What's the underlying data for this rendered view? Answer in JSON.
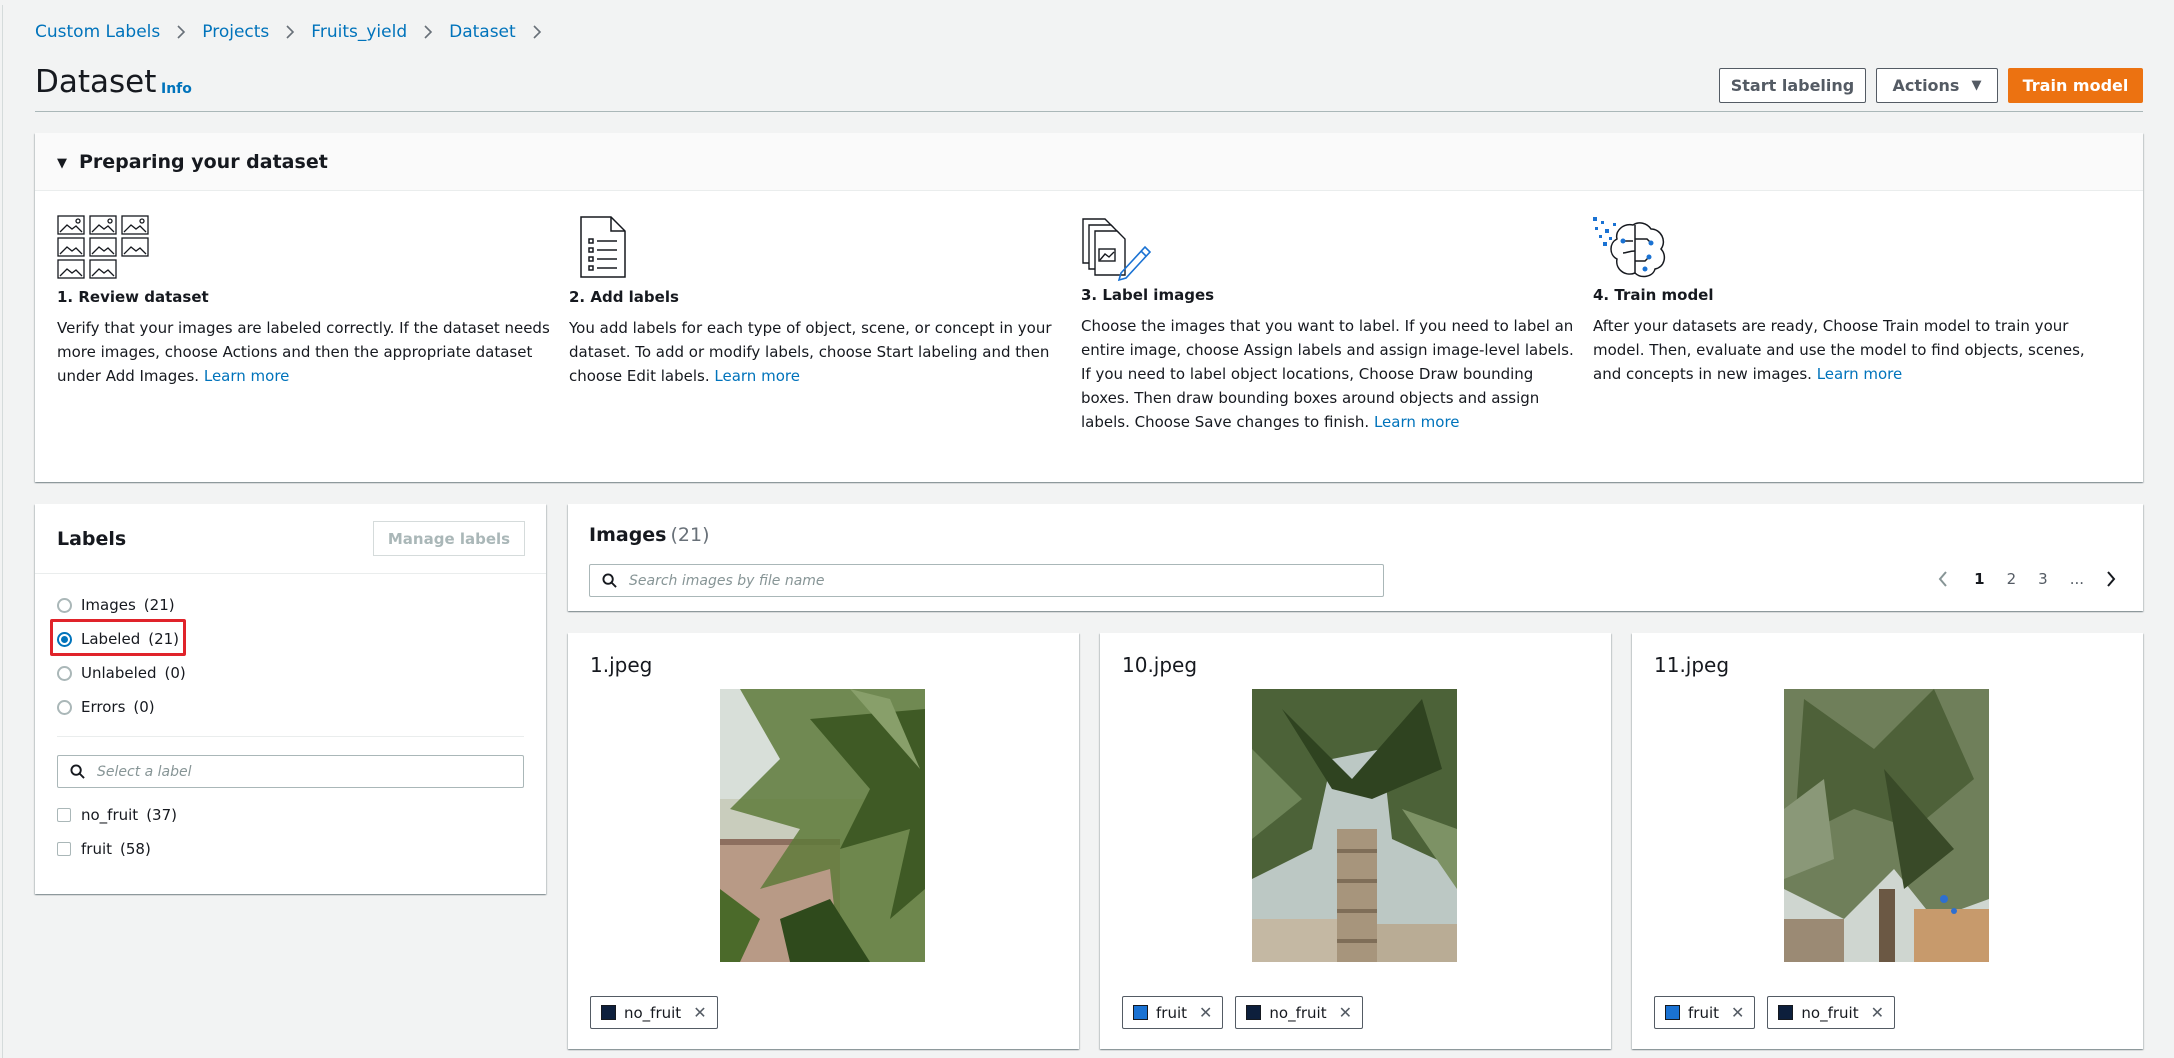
{
  "breadcrumb": [
    "Custom Labels",
    "Projects",
    "Fruits_yield",
    "Dataset"
  ],
  "header": {
    "title": "Dataset",
    "info": "Info",
    "start_labeling": "Start labeling",
    "actions": "Actions",
    "train_model": "Train model"
  },
  "prep": {
    "title": "Preparing your dataset",
    "learn_more": "Learn more",
    "steps": [
      {
        "title": "1. Review dataset",
        "text": "Verify that your images are labeled correctly. If the dataset needs more images, choose Actions and then the appropriate dataset under Add Images.",
        "icon": "image-grid-icon"
      },
      {
        "title": "2. Add labels",
        "text": "You add labels for each type of object, scene, or concept in your dataset. To add or modify labels, choose Start labeling and then choose Edit labels.",
        "icon": "document-list-icon"
      },
      {
        "title": "3. Label images",
        "text": "Choose the images that you want to label. If you need to label an entire image, choose Assign labels and assign image-level labels. If you need to label object locations, Choose Draw bounding boxes. Then draw bounding boxes around objects and assign labels. Choose Save changes to finish.",
        "icon": "label-pencil-icon"
      },
      {
        "title": "4. Train model",
        "text": "After your datasets are ready, Choose Train model to train your model. Then, evaluate and use the model to find objects, scenes, and concepts in new images.",
        "icon": "brain-circuit-icon"
      }
    ]
  },
  "labels_panel": {
    "title": "Labels",
    "manage": "Manage labels",
    "filters": [
      {
        "label": "Images",
        "count": "(21)",
        "selected": false
      },
      {
        "label": "Labeled",
        "count": "(21)",
        "selected": true
      },
      {
        "label": "Unlabeled",
        "count": "(0)",
        "selected": false
      },
      {
        "label": "Errors",
        "count": "(0)",
        "selected": false
      }
    ],
    "search_placeholder": "Select a label",
    "labels": [
      {
        "name": "no_fruit",
        "count": "(37)"
      },
      {
        "name": "fruit",
        "count": "(58)"
      }
    ]
  },
  "images_panel": {
    "title": "Images",
    "count": "(21)",
    "search_placeholder": "Search images by file name",
    "pages": [
      "1",
      "2",
      "3",
      "..."
    ],
    "current_page": "1"
  },
  "colors": {
    "accent": "#0073bb",
    "primary_button": "#ec7211",
    "no_fruit_swatch": "#0d1f3c",
    "fruit_swatch": "#1a72d3",
    "highlight": "#e0232a"
  },
  "cards": [
    {
      "name": "1.jpeg",
      "tags": [
        "no_fruit"
      ]
    },
    {
      "name": "10.jpeg",
      "tags": [
        "fruit",
        "no_fruit"
      ]
    },
    {
      "name": "11.jpeg",
      "tags": [
        "fruit",
        "no_fruit"
      ]
    }
  ]
}
